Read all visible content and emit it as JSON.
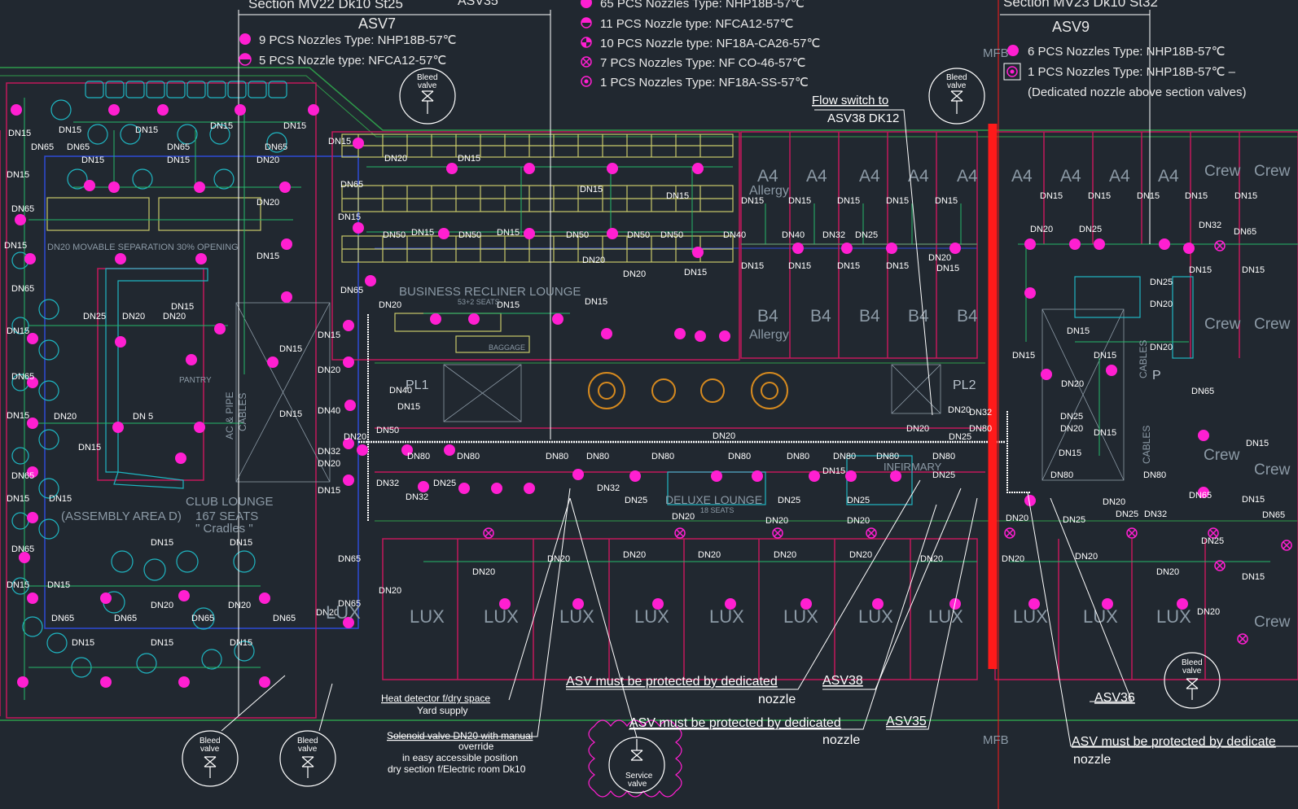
{
  "section_left": {
    "title": "Section MV22 Dk10 St25",
    "title_suffix": "ASV35",
    "asv": "ASV7",
    "legend": [
      {
        "symbol": "solid-circle",
        "text": "9 PCS Nozzles Type: NHP18B-57℃"
      },
      {
        "symbol": "half-circle",
        "text": "5 PCS  Nozzle type: NFCA12-57℃"
      }
    ]
  },
  "section_mid": {
    "legend": [
      {
        "symbol": "solid-circle",
        "text": "65 PCS Nozzles Type: NHP18B-57℃"
      },
      {
        "symbol": "half-circle",
        "text": "11 PCS  Nozzle type: NFCA12-57℃"
      },
      {
        "symbol": "quarter-circle",
        "text": "10 PCS  Nozzle type: NF18A-CA26-57℃"
      },
      {
        "symbol": "x-circle",
        "text": "7 PCS  Nozzles Type: NF CO-46-57℃"
      },
      {
        "symbol": "dot-circle",
        "text": "1 PCS  Nozzles Type: NF18A-SS-57℃"
      }
    ]
  },
  "section_right": {
    "title": "Section MV23 Dk10 St32",
    "asv": "ASV9",
    "legend": [
      {
        "symbol": "solid-circle",
        "text": "6 PCS Nozzles Type: NHP18B-57℃"
      },
      {
        "symbol": "special-circle",
        "text": "1 PCS Nozzles Type: NHP18B-57℃ –"
      },
      {
        "symbol": "none",
        "text": "(Dedicated nozzle above section valves)"
      }
    ]
  },
  "annotations": {
    "flow_switch_line1": "Flow switch to",
    "flow_switch_line2": "ASV38 DK12",
    "heat_detector_line1": "Heat detector f/dry space",
    "heat_detector_line2": "Yard supply",
    "solenoid_line1": "Solenoid valve DN20 with manual",
    "solenoid_line2": "override",
    "solenoid_line3": "in easy accessible position",
    "solenoid_line4": "dry section f/Electric room Dk10",
    "asv_protect_1": "ASV must be protected by dedicated",
    "asv_protect_1b": "nozzle",
    "asv_protect_2": "ASV must be protected by dedicated",
    "asv_protect_2b": "nozzle",
    "asv_protect_3": "ASV must be protected by dedicate",
    "asv_protect_3b": "nozzle",
    "asv38": "ASV38",
    "asv35": "ASV35",
    "asv36": "ASV36",
    "mfb_top": "MFB",
    "mfb_bottom": "MFB"
  },
  "valves": {
    "bleed_line1": "Bleed",
    "bleed_line2": "valve",
    "service_line1": "Service",
    "service_line2": "valve"
  },
  "rooms": {
    "business_lounge": "BUSINESS RECLINER LOUNGE",
    "business_seats": "53+2 SEATS",
    "club_lounge": "CLUB LOUNGE",
    "assembly_area": "(ASSEMBLY AREA D)",
    "club_seats": "167 SEATS",
    "cradles": "\" Cradles \"",
    "deluxe_lounge": "DELUXE LOUNGE",
    "deluxe_seats": "18 SEATS",
    "infirmary": "INFIRMARY",
    "pantry": "PANTRY",
    "baggage": "BAGGAGE",
    "movable": "DN20 MOVABLE SEPARATION 30% OPENING",
    "pl1": "PL1",
    "pl2": "PL2",
    "a4": "A4",
    "b4": "B4",
    "allergy": "Allergy",
    "lux": "LUX",
    "crew": "Crew",
    "cables": "CABLES",
    "ac_pipe": "AC & PIPE",
    "p": "P"
  },
  "pipe_sizes": {
    "dn15": "DN15",
    "dn20": "DN20",
    "dn25": "DN25",
    "dn32": "DN32",
    "dn40": "DN40",
    "dn50": "DN50",
    "dn65": "DN65",
    "dn80": "DN80"
  },
  "colors": {
    "background": "#212830",
    "nozzle": "#ff1fd1",
    "pipe_main": "#ffffff",
    "section_break": "#ff1a1a",
    "wall": "#c2185b",
    "furniture_cyan": "#1fb6c2",
    "furniture_yellow": "#c8c96a",
    "green_line": "#2e9b4a",
    "blue_line": "#2e4bd6"
  }
}
